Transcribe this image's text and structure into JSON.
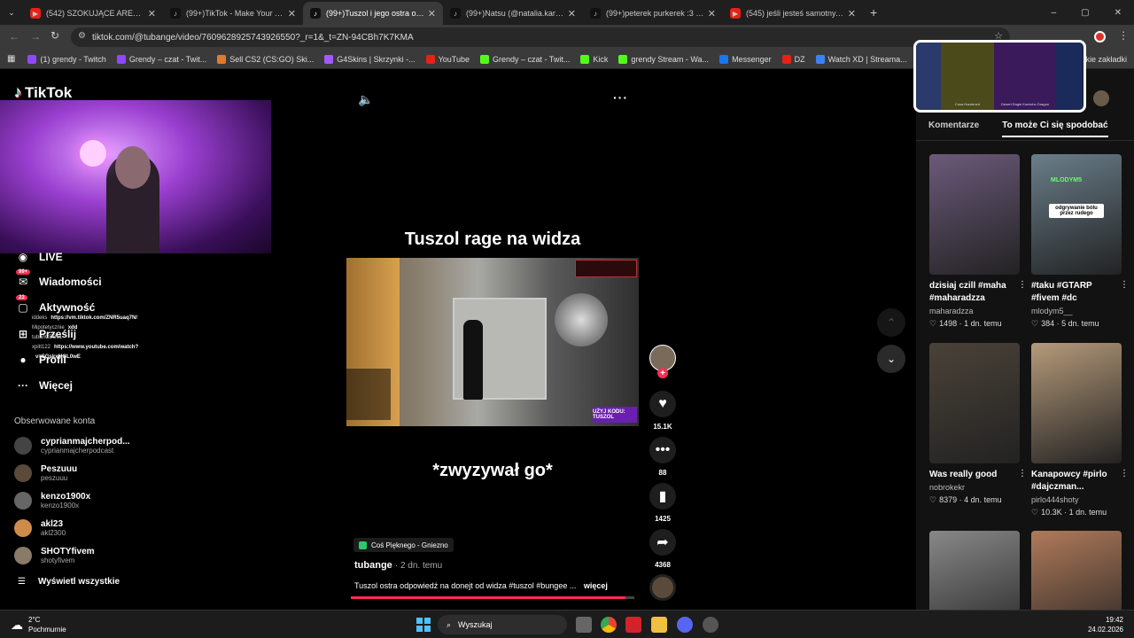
{
  "tabs": [
    {
      "title": "(542) SZOKUJĄCE ARESZTOWANIE",
      "fav": "youtube-icon",
      "color": "#e62117"
    },
    {
      "title": "(99+)TikTok - Make Your Day",
      "fav": "tiktok-icon",
      "color": "#111"
    },
    {
      "title": "(99+)Tuszol i jego ostra odp",
      "fav": "tiktok-icon",
      "color": "#111",
      "active": true
    },
    {
      "title": "(99+)Natsu (@natalia.karczmarz)",
      "fav": "tiktok-icon",
      "color": "#111"
    },
    {
      "title": "(99+)peterek purkerek :3 #peterek",
      "fav": "tiktok-icon",
      "color": "#111"
    },
    {
      "title": "(545) jeśli jesteś samotny, ten film",
      "fav": "youtube-icon",
      "color": "#e62117"
    }
  ],
  "url": "tiktok.com/@tubange/video/7609628925743926550?_r=1&_t=ZN-94CBh7K7KMA",
  "bookmarks": [
    {
      "label": "(1) grendy - Twitch",
      "color": "#9146ff"
    },
    {
      "label": "Grendy – czat - Twit...",
      "color": "#9146ff"
    },
    {
      "label": "Sell CS2 (CS:GO) Ski...",
      "color": "#e07b2a"
    },
    {
      "label": "G4Skins | Skrzynki -...",
      "color": "#a259ff"
    },
    {
      "label": "YouTube",
      "color": "#e62117"
    },
    {
      "label": "Grendy – czat - Twit...",
      "color": "#53fc18"
    },
    {
      "label": "Kick",
      "color": "#53fc18"
    },
    {
      "label": "grendy Stream - Wa...",
      "color": "#53fc18"
    },
    {
      "label": "Messenger",
      "color": "#1877f2"
    },
    {
      "label": "DZ",
      "color": "#e62117"
    },
    {
      "label": "Watch XD | Streama...",
      "color": "#3b82f6"
    }
  ],
  "bookmarks_more": "tkie zakładki",
  "sidebar": {
    "logo": "TikTok",
    "nav": [
      {
        "label": "LIVE",
        "icon": "live-icon"
      },
      {
        "label": "Wiadomości",
        "icon": "messages-icon",
        "badge": "99+"
      },
      {
        "label": "Aktywność",
        "icon": "activity-icon",
        "badge": "23"
      },
      {
        "label": "Prześlij",
        "icon": "upload-icon"
      },
      {
        "label": "Profil",
        "icon": "avatar"
      },
      {
        "label": "Więcej",
        "icon": "more-icon"
      }
    ],
    "chat_overlay": [
      {
        "user": "iddeks",
        "msg": "https://vm.tiktok.com/ZNR5uaq7N/"
      },
      {
        "user": "Mipotetycznie",
        "msg": "xdd"
      },
      {
        "user": "tubanCBB91",
        "msg": ""
      },
      {
        "user": "xpitt122",
        "msg": "https://www.youtube.com/watch?"
      },
      {
        "user": "",
        "msg": "v=SGskxMGL0wE"
      }
    ],
    "followed_title": "Obserwowane konta",
    "followed": [
      {
        "name": "cyprianmajcherpod...",
        "handle": "cyprianmajcherpodcast",
        "color": "#444"
      },
      {
        "name": "Peszuuu",
        "handle": "peszuuu",
        "color": "#5a4a3a"
      },
      {
        "name": "kenzo1900x",
        "handle": "kenzo1900x",
        "color": "#666"
      },
      {
        "name": "akl23",
        "handle": "akl2300",
        "color": "#d08a4a"
      },
      {
        "name": "SHOTYfivem",
        "handle": "shotyfivem",
        "color": "#8a7a6a"
      }
    ],
    "show_all": "Wyświetl wszystkie"
  },
  "video": {
    "top_caption": "Tuszol rage na widza",
    "bottom_caption": "*zwyzywał go*",
    "location": "Coś Pięknego - Gniezno",
    "author": "tubange",
    "age": "· 2 dn. temu",
    "description": "Tuszol ostra odpowiedź na donejt od widza #tuszol #bungee ...",
    "more": "więcej",
    "overlay_code": "UŻYJ KODU: TUSZOL",
    "progress": 0.97
  },
  "actions": {
    "likes": "15.1K",
    "comments": "88",
    "saves": "1425",
    "shares": "4368"
  },
  "right_panel": {
    "tabs": [
      "Komentarze",
      "To może Ci się spodobać"
    ],
    "active_tab": 1,
    "cards": [
      {
        "caption": "dzisiaj czill #maha #maharadzza",
        "author": "maharadzza",
        "likes": "1498",
        "age": "1 dn. temu",
        "color": "#6b5a7a"
      },
      {
        "caption": "#taku #GTARP #fivem #dc",
        "author": "mlodym5__",
        "likes": "384",
        "age": "5 dn. temu",
        "color": "#6a7e8a",
        "overlay": "odgrywanie bólu przez rudego",
        "tag": "MLODYM5"
      },
      {
        "caption": "Was really good",
        "author": "nobrokekr",
        "likes": "8379",
        "age": "4 dn. temu",
        "color": "#4a4238"
      },
      {
        "caption": "Kanapowcy #pirlo #dajczman...",
        "author": "pirlo444shoty",
        "likes": "10.3K",
        "age": "1 dn. temu",
        "color": "#b59a7a"
      },
      {
        "caption": "",
        "author": "",
        "likes": "",
        "age": "",
        "color": "#888"
      },
      {
        "caption": "",
        "author": "",
        "likes": "",
        "age": "",
        "color": "#b07a5a"
      }
    ],
    "popup_labels": [
      "Cosa Hardened",
      "Desert Eagle Kumicho Dragon"
    ]
  },
  "taskbar": {
    "weather_temp": "2°C",
    "weather_desc": "Pochmurnie",
    "search": "Wyszukaj",
    "time": "19:42",
    "date": "24.02.2026"
  }
}
